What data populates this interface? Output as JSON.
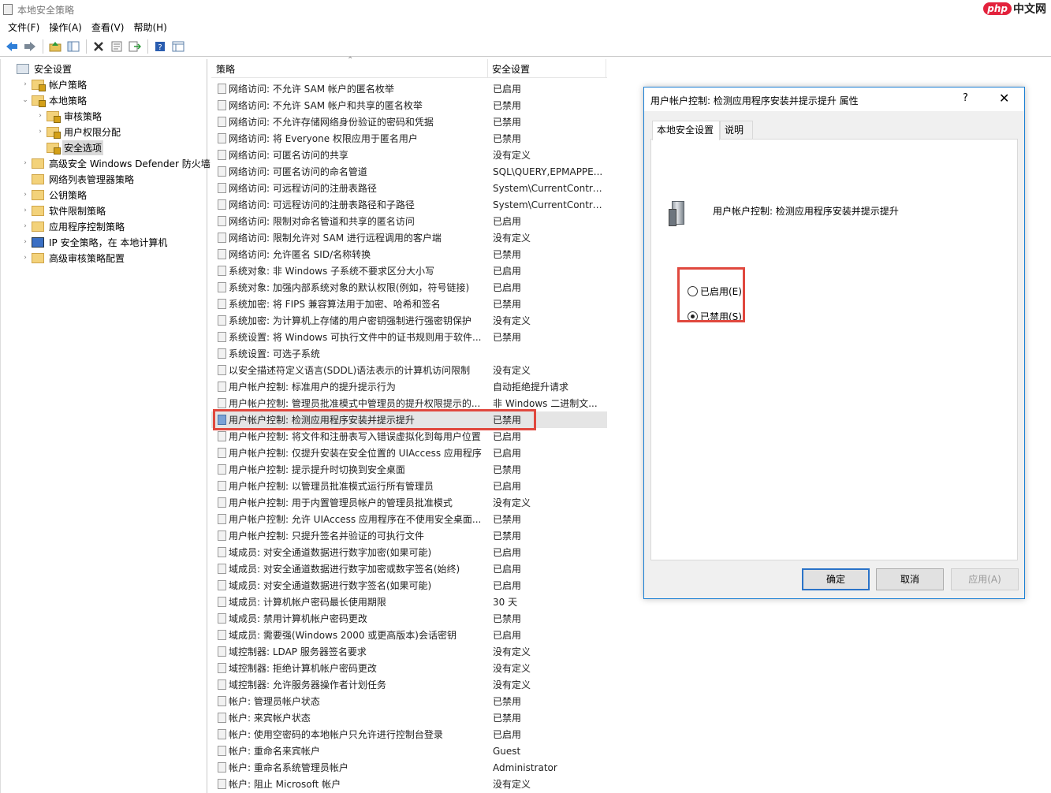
{
  "window": {
    "title": "本地安全策略"
  },
  "watermark": {
    "logo": "php",
    "text": "中文网"
  },
  "menu": [
    "文件(F)",
    "操作(A)",
    "查看(V)",
    "帮助(H)"
  ],
  "toolbar": {
    "icons": [
      "back-arrow-icon",
      "forward-arrow-icon",
      "up-folder-icon",
      "show-tree-icon",
      "delete-icon",
      "properties-icon",
      "export-list-icon",
      "help-icon",
      "view-icon"
    ]
  },
  "tree": [
    {
      "label": "安全设置",
      "level": 0,
      "expand": "",
      "icon": "root",
      "selected": false
    },
    {
      "label": "帐户策略",
      "level": 1,
      "expand": "›",
      "icon": "lock",
      "selected": false
    },
    {
      "label": "本地策略",
      "level": 1,
      "expand": "⌄",
      "icon": "lock",
      "selected": false
    },
    {
      "label": "审核策略",
      "level": 2,
      "expand": "›",
      "icon": "lock",
      "selected": false
    },
    {
      "label": "用户权限分配",
      "level": 2,
      "expand": "›",
      "icon": "lock",
      "selected": false
    },
    {
      "label": "安全选项",
      "level": 2,
      "expand": "",
      "icon": "lock",
      "selected": true
    },
    {
      "label": "高级安全 Windows Defender 防火墙",
      "level": 1,
      "expand": "›",
      "icon": "folder",
      "selected": false
    },
    {
      "label": "网络列表管理器策略",
      "level": 1,
      "expand": "",
      "icon": "folder",
      "selected": false
    },
    {
      "label": "公钥策略",
      "level": 1,
      "expand": "›",
      "icon": "folder",
      "selected": false
    },
    {
      "label": "软件限制策略",
      "level": 1,
      "expand": "›",
      "icon": "folder",
      "selected": false
    },
    {
      "label": "应用程序控制策略",
      "level": 1,
      "expand": "›",
      "icon": "folder",
      "selected": false
    },
    {
      "label": "IP 安全策略，在 本地计算机",
      "level": 1,
      "expand": "›",
      "icon": "shield",
      "selected": false
    },
    {
      "label": "高级审核策略配置",
      "level": 1,
      "expand": "›",
      "icon": "folder",
      "selected": false
    }
  ],
  "list": {
    "col_policy": "策略",
    "col_setting": "安全设置",
    "selected_index": 20,
    "rows": [
      {
        "policy": "网络访问: 不允许 SAM 帐户的匿名枚举",
        "setting": "已启用"
      },
      {
        "policy": "网络访问: 不允许 SAM 帐户和共享的匿名枚举",
        "setting": "已禁用"
      },
      {
        "policy": "网络访问: 不允许存储网络身份验证的密码和凭据",
        "setting": "已禁用"
      },
      {
        "policy": "网络访问: 将 Everyone 权限应用于匿名用户",
        "setting": "已禁用"
      },
      {
        "policy": "网络访问: 可匿名访问的共享",
        "setting": "没有定义"
      },
      {
        "policy": "网络访问: 可匿名访问的命名管道",
        "setting": "SQL\\QUERY,EPMAPPE..."
      },
      {
        "policy": "网络访问: 可远程访问的注册表路径",
        "setting": "System\\CurrentContro..."
      },
      {
        "policy": "网络访问: 可远程访问的注册表路径和子路径",
        "setting": "System\\CurrentContro..."
      },
      {
        "policy": "网络访问: 限制对命名管道和共享的匿名访问",
        "setting": "已启用"
      },
      {
        "policy": "网络访问: 限制允许对 SAM 进行远程调用的客户端",
        "setting": "没有定义"
      },
      {
        "policy": "网络访问: 允许匿名 SID/名称转换",
        "setting": "已禁用"
      },
      {
        "policy": "系统对象: 非 Windows 子系统不要求区分大小写",
        "setting": "已启用"
      },
      {
        "policy": "系统对象: 加强内部系统对象的默认权限(例如，符号链接)",
        "setting": "已启用"
      },
      {
        "policy": "系统加密: 将 FIPS 兼容算法用于加密、哈希和签名",
        "setting": "已禁用"
      },
      {
        "policy": "系统加密: 为计算机上存储的用户密钥强制进行强密钥保护",
        "setting": "没有定义"
      },
      {
        "policy": "系统设置: 将 Windows 可执行文件中的证书规则用于软件...",
        "setting": "已禁用"
      },
      {
        "policy": "系统设置: 可选子系统",
        "setting": ""
      },
      {
        "policy": "以安全描述符定义语言(SDDL)语法表示的计算机访问限制",
        "setting": "没有定义"
      },
      {
        "policy": "用户帐户控制: 标准用户的提升提示行为",
        "setting": "自动拒绝提升请求"
      },
      {
        "policy": "用户帐户控制: 管理员批准模式中管理员的提升权限提示的...",
        "setting": "非 Windows 二进制文..."
      },
      {
        "policy": "用户帐户控制: 检测应用程序安装并提示提升",
        "setting": "已禁用"
      },
      {
        "policy": "用户帐户控制: 将文件和注册表写入错误虚拟化到每用户位置",
        "setting": "已启用"
      },
      {
        "policy": "用户帐户控制: 仅提升安装在安全位置的 UIAccess 应用程序",
        "setting": "已启用"
      },
      {
        "policy": "用户帐户控制: 提示提升时切换到安全桌面",
        "setting": "已禁用"
      },
      {
        "policy": "用户帐户控制: 以管理员批准模式运行所有管理员",
        "setting": "已启用"
      },
      {
        "policy": "用户帐户控制: 用于内置管理员帐户的管理员批准模式",
        "setting": "没有定义"
      },
      {
        "policy": "用户帐户控制: 允许 UIAccess 应用程序在不使用安全桌面...",
        "setting": "已禁用"
      },
      {
        "policy": "用户帐户控制: 只提升签名并验证的可执行文件",
        "setting": "已禁用"
      },
      {
        "policy": "域成员: 对安全通道数据进行数字加密(如果可能)",
        "setting": "已启用"
      },
      {
        "policy": "域成员: 对安全通道数据进行数字加密或数字签名(始终)",
        "setting": "已启用"
      },
      {
        "policy": "域成员: 对安全通道数据进行数字签名(如果可能)",
        "setting": "已启用"
      },
      {
        "policy": "域成员: 计算机帐户密码最长使用期限",
        "setting": "30 天"
      },
      {
        "policy": "域成员: 禁用计算机帐户密码更改",
        "setting": "已禁用"
      },
      {
        "policy": "域成员: 需要强(Windows 2000 或更高版本)会话密钥",
        "setting": "已启用"
      },
      {
        "policy": "域控制器: LDAP 服务器签名要求",
        "setting": "没有定义"
      },
      {
        "policy": "域控制器: 拒绝计算机帐户密码更改",
        "setting": "没有定义"
      },
      {
        "policy": "域控制器: 允许服务器操作者计划任务",
        "setting": "没有定义"
      },
      {
        "policy": "帐户: 管理员帐户状态",
        "setting": "已禁用"
      },
      {
        "policy": "帐户: 来宾帐户状态",
        "setting": "已禁用"
      },
      {
        "policy": "帐户: 使用空密码的本地帐户只允许进行控制台登录",
        "setting": "已启用"
      },
      {
        "policy": "帐户: 重命名来宾帐户",
        "setting": "Guest"
      },
      {
        "policy": "帐户: 重命名系统管理员帐户",
        "setting": "Administrator"
      },
      {
        "policy": "帐户: 阻止 Microsoft 帐户",
        "setting": "没有定义"
      }
    ]
  },
  "dialog": {
    "title": "用户帐户控制: 检测应用程序安装并提示提升 属性",
    "help": "?",
    "close": "✕",
    "tabs": [
      "本地安全设置",
      "说明"
    ],
    "active_tab": 0,
    "policy_name": "用户帐户控制: 检测应用程序安装并提示提升",
    "options": [
      {
        "label": "已启用(E)",
        "checked": false
      },
      {
        "label": "已禁用(S)",
        "checked": true
      }
    ],
    "buttons": {
      "ok": "确定",
      "cancel": "取消",
      "apply": "应用(A)"
    },
    "apply_enabled": false
  },
  "colors": {
    "highlight": "#e0483e",
    "dialog_border": "#1a7fd4",
    "selection": "#e5e5e5"
  }
}
